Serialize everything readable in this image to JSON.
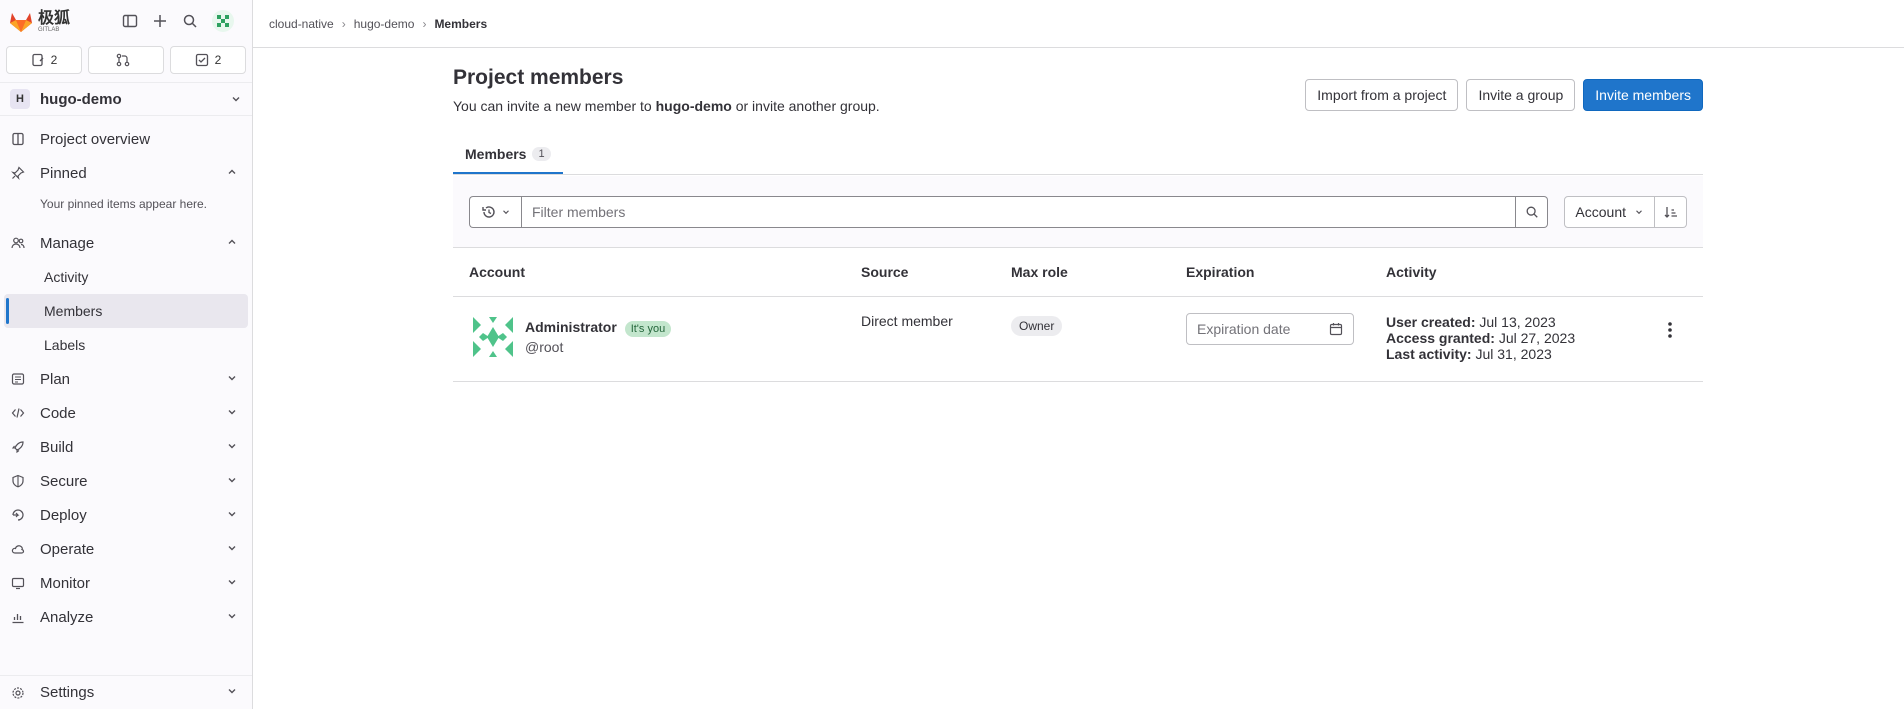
{
  "sidebar": {
    "logo_text": "极狐",
    "logo_sub": "GITLAB",
    "counters": [
      {
        "icon": "issues-icon",
        "value": "2"
      },
      {
        "icon": "merge-request-icon",
        "value": ""
      },
      {
        "icon": "todo-icon",
        "value": "2"
      }
    ],
    "project": {
      "initial": "H",
      "name": "hugo-demo"
    },
    "project_overview": "Project overview",
    "pinned": "Pinned",
    "pinned_note": "Your pinned items appear here.",
    "manage": "Manage",
    "manage_items": [
      "Activity",
      "Members",
      "Labels"
    ],
    "sections": [
      "Plan",
      "Code",
      "Build",
      "Secure",
      "Deploy",
      "Operate",
      "Monitor",
      "Analyze",
      "Settings"
    ]
  },
  "breadcrumb": {
    "items": [
      "cloud-native",
      "hugo-demo"
    ],
    "current": "Members"
  },
  "page": {
    "title": "Project members",
    "subtitle_prefix": "You can invite a new member to ",
    "subtitle_project": "hugo-demo",
    "subtitle_suffix": " or invite another group.",
    "buttons": {
      "import": "Import from a project",
      "invite_group": "Invite a group",
      "invite_members": "Invite members"
    },
    "tab": {
      "label": "Members",
      "count": "1"
    },
    "filter": {
      "placeholder": "Filter members",
      "sort_label": "Account"
    },
    "table": {
      "headers": [
        "Account",
        "Source",
        "Max role",
        "Expiration",
        "Activity"
      ],
      "row": {
        "name": "Administrator",
        "badge": "It's you",
        "handle": "@root",
        "source": "Direct member",
        "role": "Owner",
        "expiration_placeholder": "Expiration date",
        "created_label": "User created:",
        "created_value": "Jul 13, 2023",
        "granted_label": "Access granted:",
        "granted_value": "Jul 27, 2023",
        "last_label": "Last activity:",
        "last_value": "Jul 31, 2023"
      }
    }
  },
  "colors": {
    "accent": "#1f75cb",
    "badge_green": "#c3e6cd"
  }
}
